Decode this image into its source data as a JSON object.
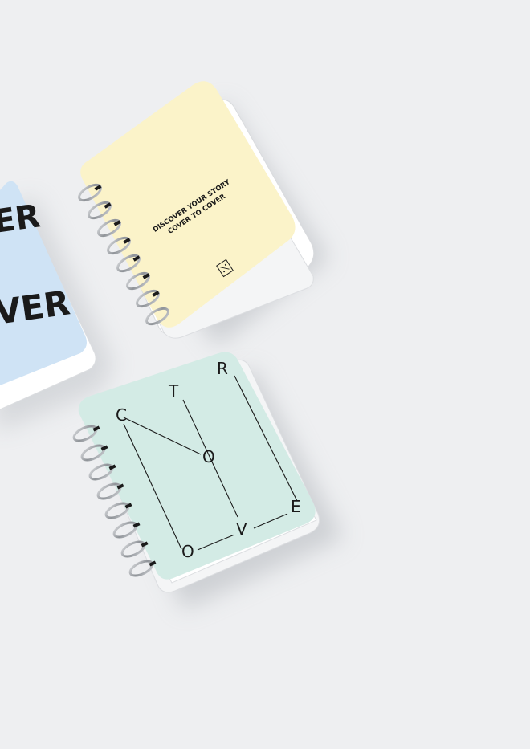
{
  "blue_notebook": {
    "cover_line_1": "ER",
    "cover_line_2": "VER",
    "cover_color": "#cfe3f5"
  },
  "yellow_notebook": {
    "tagline_line_1": "DISCOVER YOUR STORY",
    "tagline_line_2": "COVER TO COVER",
    "cover_color": "#fbf3c9"
  },
  "mint_notebook": {
    "letters": [
      "C",
      "T",
      "R",
      "O",
      "V",
      "E",
      "O"
    ],
    "cover_color": "#d3ebe5"
  },
  "colors": {
    "background": "#eeeff1",
    "ink": "#1a1a1a",
    "spiral": "#9a9da2"
  }
}
